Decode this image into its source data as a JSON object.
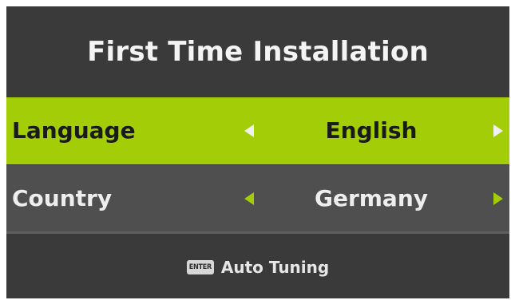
{
  "header": {
    "title": "First Time Installation"
  },
  "settings": [
    {
      "label": "Language",
      "value": "English",
      "left_arrow_icon": "triangle-left-icon",
      "right_arrow_icon": "triangle-right-icon",
      "selected": true
    },
    {
      "label": "Country",
      "value": "Germany",
      "left_arrow_icon": "triangle-left-icon",
      "right_arrow_icon": "triangle-right-icon",
      "selected": false
    }
  ],
  "footer": {
    "key_label": "ENTER",
    "action_label": "Auto Tuning"
  },
  "colors": {
    "background": "#3a3a3a",
    "highlight": "#a3cd07",
    "row": "#4f4f4f",
    "text_light": "#eeeeee",
    "text_dark": "#1a1a1a"
  }
}
